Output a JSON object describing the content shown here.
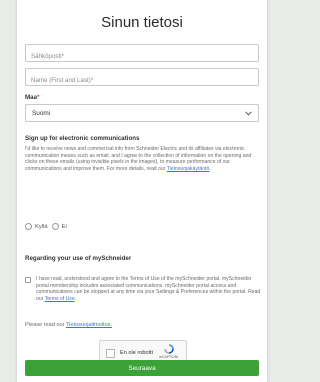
{
  "page": {
    "title": "Sinun tietosi"
  },
  "form": {
    "email_placeholder": "Sähköposti*",
    "name_placeholder": "Name (First and Last)*",
    "country_label": "Maa",
    "required_mark": "*",
    "country_value": "Suomi"
  },
  "communications": {
    "heading": "Sign up for electronic communications",
    "text": "I'd like to receive news and commercial info from Schneider Electric and its affiliates via electronic communication means such as email, and I agree to the collection of information on the opening and clicks on these emails (using invisible pixels in the images), to measure performance of our communications and improve them. For more details, read our ",
    "link": "Tietosuojakäytäntö",
    "tail": ".",
    "yes_label": "Kyllä",
    "no_label": "Ei"
  },
  "myschneider": {
    "heading": "Regarding your use of mySchneider",
    "text": "I have read, understood and agree to the Terms of Use of the mySchneider portal. mySchneider portal membership includes associated communications. mySchneider portal access and communications can be stopped at any time via your Settings & Preferences within the portal. Read our ",
    "link": "Terms of Use",
    "tail": ".",
    "read_prefix": "Please read our ",
    "privacy_link": "Tietosuojailmoitus."
  },
  "captcha": {
    "label": "En ole robotti",
    "brand": "reCAPTCHA",
    "terms": "Tietosuoja - Ehdot"
  },
  "actions": {
    "submit": "Seuraava"
  },
  "colors": {
    "accent_green": "#3aa237",
    "link_blue": "#3b78c8",
    "required_red": "#e0413a"
  }
}
